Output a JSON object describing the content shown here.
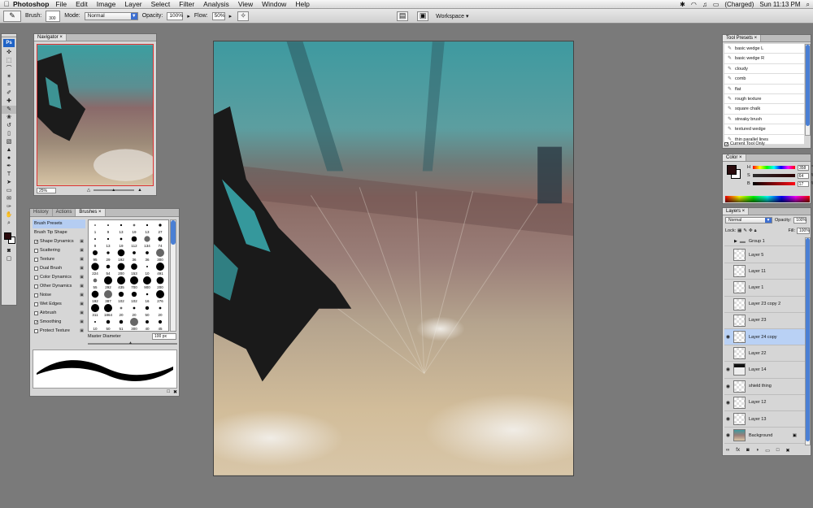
{
  "menubar": {
    "app_name": "Photoshop",
    "items": [
      "File",
      "Edit",
      "Image",
      "Layer",
      "Select",
      "Filter",
      "Analysis",
      "View",
      "Window",
      "Help"
    ],
    "battery": "(Charged)",
    "clock": "Sun 11:13 PM"
  },
  "options": {
    "brush_label": "Brush:",
    "brush_size": "300",
    "mode_label": "Mode:",
    "mode_value": "Normal",
    "opacity_label": "Opacity:",
    "opacity_value": "100%",
    "flow_label": "Flow:",
    "flow_value": "50%",
    "workspace_label": "Workspace"
  },
  "tools": {
    "logo": "Ps"
  },
  "navigator": {
    "tab": "Navigator",
    "zoom": "25%"
  },
  "brushes": {
    "tabs": [
      "History",
      "Actions",
      "Brushes"
    ],
    "items": [
      {
        "label": "Brush Presets",
        "checkbox": false,
        "checked": false,
        "locked": false,
        "selected": true
      },
      {
        "label": "Brush Tip Shape",
        "checkbox": false,
        "checked": false,
        "locked": false,
        "selected": false
      },
      {
        "label": "Shape Dynamics",
        "checkbox": true,
        "checked": true,
        "locked": true,
        "selected": false
      },
      {
        "label": "Scattering",
        "checkbox": true,
        "checked": false,
        "locked": true,
        "selected": false
      },
      {
        "label": "Texture",
        "checkbox": true,
        "checked": false,
        "locked": true,
        "selected": false
      },
      {
        "label": "Dual Brush",
        "checkbox": true,
        "checked": false,
        "locked": true,
        "selected": false
      },
      {
        "label": "Color Dynamics",
        "checkbox": true,
        "checked": false,
        "locked": true,
        "selected": false
      },
      {
        "label": "Other Dynamics",
        "checkbox": true,
        "checked": false,
        "locked": true,
        "selected": false
      },
      {
        "label": "Noise",
        "checkbox": true,
        "checked": false,
        "locked": true,
        "selected": false
      },
      {
        "label": "Wet Edges",
        "checkbox": true,
        "checked": false,
        "locked": true,
        "selected": false
      },
      {
        "label": "Airbrush",
        "checkbox": true,
        "checked": false,
        "locked": true,
        "selected": false
      },
      {
        "label": "Smoothing",
        "checkbox": true,
        "checked": true,
        "locked": true,
        "selected": false
      },
      {
        "label": "Protect Texture",
        "checkbox": true,
        "checked": false,
        "locked": true,
        "selected": false
      }
    ],
    "sizes": [
      "1",
      "9",
      "13",
      "19",
      "13",
      "27",
      "9",
      "13",
      "19",
      "112",
      "134",
      "74",
      "95",
      "29",
      "192",
      "36",
      "36",
      "300",
      "224",
      "54",
      "200",
      "153",
      "10",
      "491",
      "55",
      "292",
      "435",
      "700",
      "900",
      "200",
      "192",
      "387",
      "102",
      "102",
      "16",
      "276",
      "311",
      "1864",
      "20",
      "20",
      "50",
      "20",
      "10",
      "50",
      "51",
      "300",
      "40",
      "45"
    ],
    "master_label": "Master Diameter",
    "master_value": "100 px"
  },
  "presets": {
    "tab": "Tool Presets",
    "items": [
      "basic wedge L",
      "basic wedge R",
      "cloudy",
      "comb",
      "flat",
      "rough texture",
      "square chalk",
      "streaky brush",
      "textured wedge",
      "thin parallel lines"
    ],
    "current_only": "Current Tool Only"
  },
  "color": {
    "tab": "Color",
    "h_label": "H",
    "h_value": "358",
    "s_label": "S",
    "s_value": "64",
    "b_label": "B",
    "b_value": "17",
    "unit_deg": "°",
    "unit_pct": "%"
  },
  "layers": {
    "tab": "Layers",
    "blend": "Normal",
    "opacity_label": "Opacity:",
    "opacity_value": "100%",
    "lock_label": "Lock:",
    "fill_label": "Fill:",
    "fill_value": "100%",
    "group_name": "Group 1",
    "rows": [
      {
        "name": "Layer 5",
        "visible": false,
        "active": false
      },
      {
        "name": "Layer 11",
        "visible": false,
        "active": false
      },
      {
        "name": "Layer 1",
        "visible": false,
        "active": false
      },
      {
        "name": "Layer 23 copy 2",
        "visible": false,
        "active": false
      },
      {
        "name": "Layer 23",
        "visible": false,
        "active": false
      },
      {
        "name": "Layer 24 copy",
        "visible": true,
        "active": true
      },
      {
        "name": "Layer 22",
        "visible": false,
        "active": false
      },
      {
        "name": "Layer 14",
        "visible": true,
        "active": false
      },
      {
        "name": "shield thing",
        "visible": true,
        "active": false
      },
      {
        "name": "Layer 12",
        "visible": true,
        "active": false
      },
      {
        "name": "Layer 13",
        "visible": true,
        "active": false
      },
      {
        "name": "Background",
        "visible": true,
        "active": false
      }
    ]
  }
}
